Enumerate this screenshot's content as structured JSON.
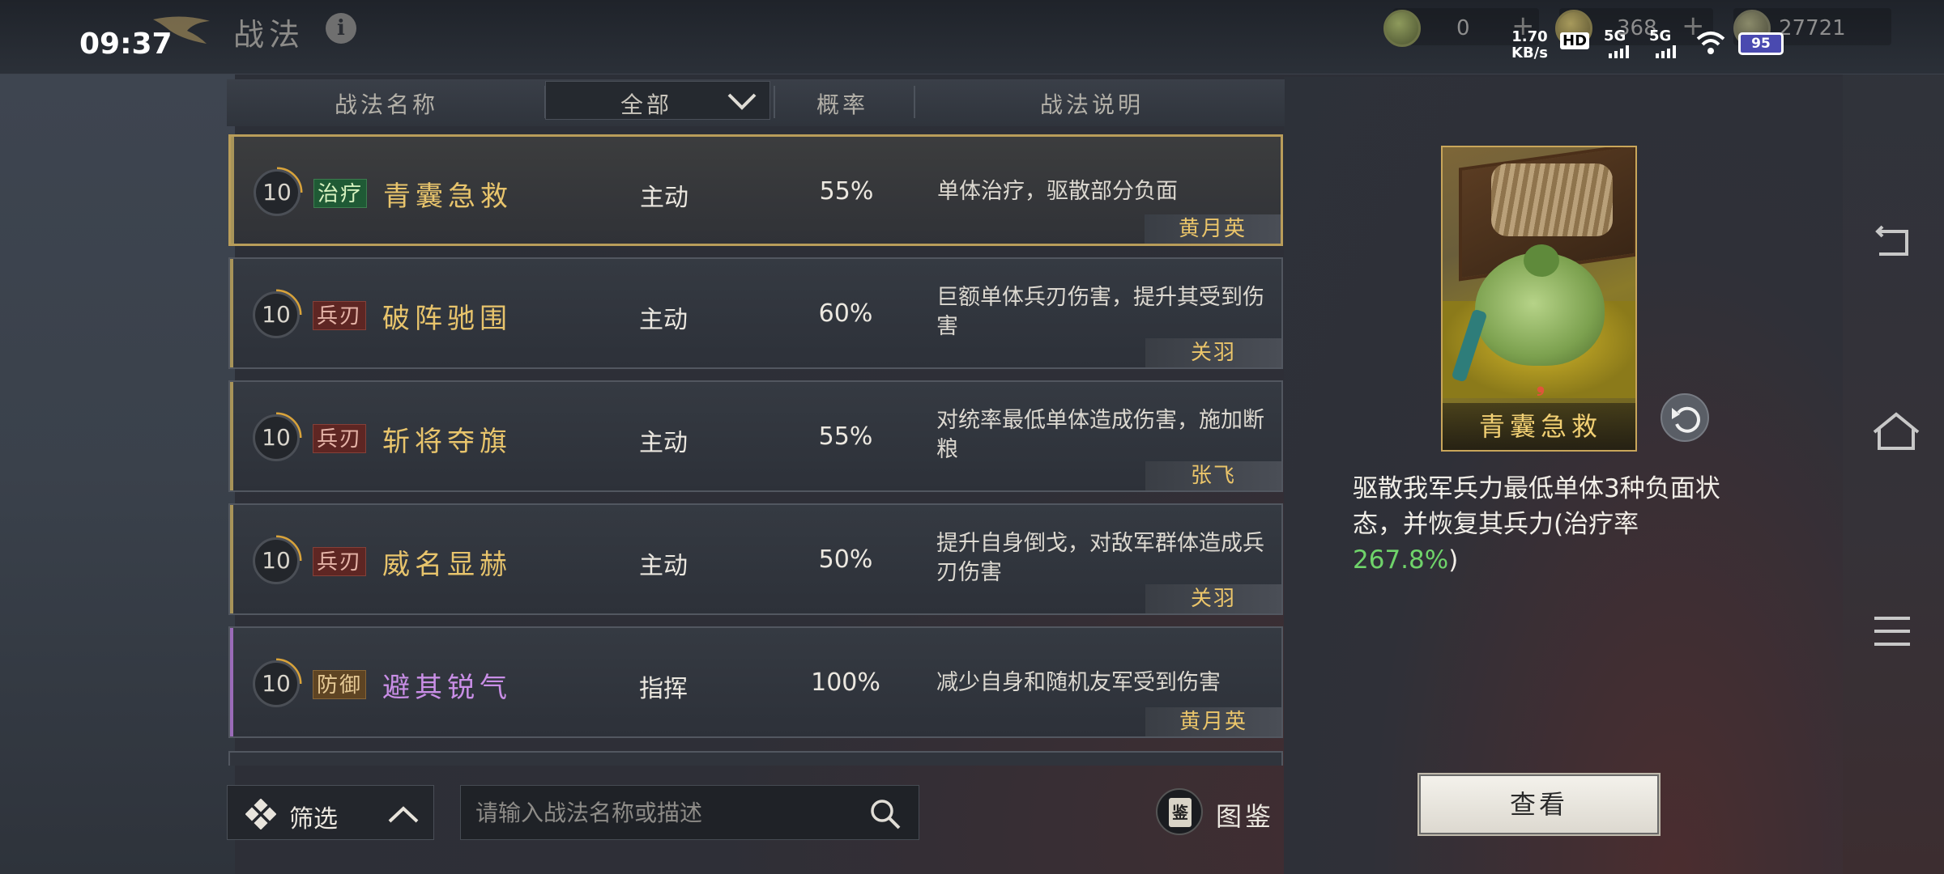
{
  "status": {
    "time": "09:37",
    "net_speed_value": "1.70",
    "net_speed_unit": "KB/s",
    "hd_label": "HD",
    "sim1": "5G",
    "sim2": "5G",
    "battery": "95"
  },
  "header": {
    "title": "战法",
    "info_label": "i",
    "resources": [
      {
        "value": "0"
      },
      {
        "value": "368"
      },
      {
        "value": "27721"
      }
    ]
  },
  "table": {
    "col_name": "战法名称",
    "filter_value": "全部",
    "col_rate": "概率",
    "col_desc": "战法说明",
    "rows": [
      {
        "level": "10",
        "tag": "治疗",
        "name": "青囊急救",
        "type": "主动",
        "rate": "55%",
        "desc": "单体治疗，驱散部分负面",
        "hero": "黄月英"
      },
      {
        "level": "10",
        "tag": "兵刃",
        "name": "破阵驰围",
        "type": "主动",
        "rate": "60%",
        "desc": "巨额单体兵刃伤害，提升其受到伤害",
        "hero": "关羽"
      },
      {
        "level": "10",
        "tag": "兵刃",
        "name": "斩将夺旗",
        "type": "主动",
        "rate": "55%",
        "desc": "对统率最低单体造成伤害，施加断粮",
        "hero": "张飞"
      },
      {
        "level": "10",
        "tag": "兵刃",
        "name": "威名显赫",
        "type": "主动",
        "rate": "50%",
        "desc": "提升自身倒戈，对敌军群体造成兵刃伤害",
        "hero": "关羽"
      },
      {
        "level": "10",
        "tag": "防御",
        "name": "避其锐气",
        "type": "指挥",
        "rate": "100%",
        "desc": "减少自身和随机友军受到伤害",
        "hero": "黄月英"
      }
    ]
  },
  "bottom": {
    "filter_label": "筛选",
    "search_placeholder": "请输入战法名称或描述",
    "codex_icon_char": "鉴",
    "codex_label": "图鉴"
  },
  "detail": {
    "card_name": "青囊急救",
    "desc_main": "驱散我军兵力最低单体3种负面状态，并恢复其兵力(治疗率",
    "desc_value": "267.8%",
    "desc_end": ")",
    "view_button": "查看"
  },
  "colors": {
    "gold": "#e8c46c",
    "purple": "#c98ee6",
    "heal_green": "#6fd36a"
  }
}
